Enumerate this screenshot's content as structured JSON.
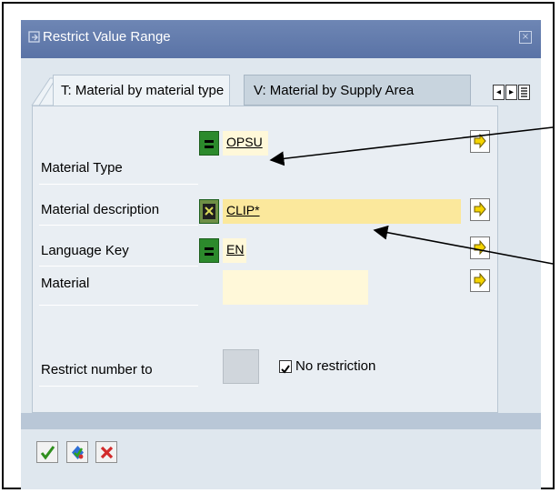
{
  "window": {
    "title": "Restrict Value Range",
    "close_glyph": "×"
  },
  "tabs": [
    {
      "label": "T: Material by material type",
      "active": true
    },
    {
      "label": "V: Material by Supply Area",
      "active": false
    }
  ],
  "tab_nav": {
    "prev_glyph": "◂",
    "next_glyph": "▸",
    "menu_icon": "tab-list-icon"
  },
  "fields": [
    {
      "label": "Material Type",
      "operator": "=",
      "value": "OPSU"
    },
    {
      "label": "Material description",
      "operator": "pattern",
      "value": "CLIP*"
    },
    {
      "label": "Language Key",
      "operator": "=",
      "value": "EN"
    },
    {
      "label": "Material",
      "operator": "",
      "value": ""
    }
  ],
  "restrict": {
    "label": "Restrict number to",
    "value": "",
    "checkbox_label": "No restriction",
    "checked": true,
    "check_glyph": "✔"
  },
  "toolbar": {
    "ok_icon": "checkmark-icon",
    "start_icon": "start-search-icon",
    "cancel_icon": "cancel-icon"
  },
  "colors": {
    "title_bar": "#5f77a9",
    "panel": "#e9eef3",
    "field_yellow": "#fff8d9",
    "operator_green": "#2c8a2c"
  }
}
